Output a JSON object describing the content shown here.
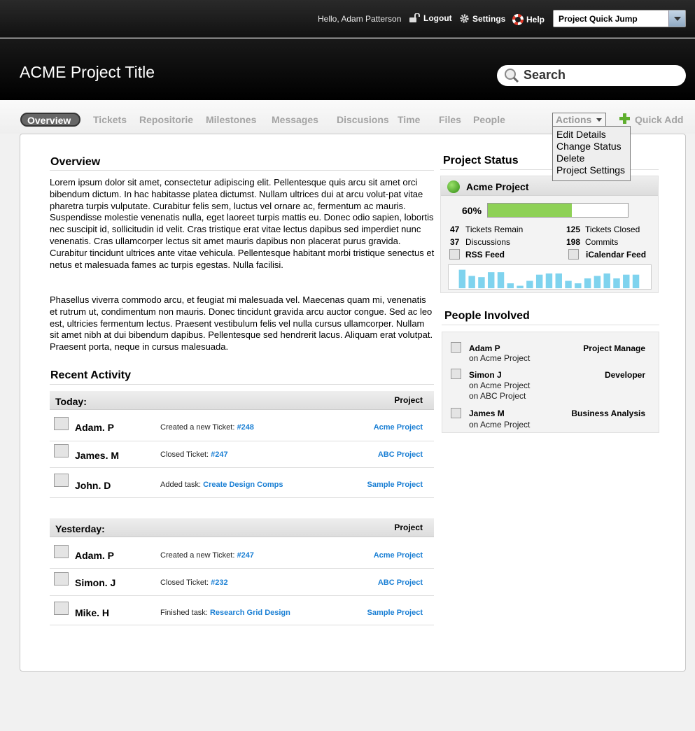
{
  "topbar": {
    "greeting": "Hello, Adam Patterson",
    "logout": "Logout",
    "settings": "Settings",
    "help": "Help",
    "quick_jump": "Project Quick Jump"
  },
  "header": {
    "title": "ACME Project Title",
    "search_placeholder": "Search"
  },
  "nav": {
    "items": [
      "Overview",
      "Tickets",
      "Repositorie",
      "Milestones",
      "Messages",
      "Discusions",
      "Time",
      "Files",
      "People"
    ],
    "actions": "Actions",
    "actions_menu": [
      "Edit Details",
      "Change Status",
      "Delete",
      "Project Settings"
    ],
    "quick_add": "Quick Add"
  },
  "overview": {
    "heading": "Overview",
    "para1": "Lorem ipsum dolor sit amet, consectetur adipiscing elit. Pellentesque quis arcu sit amet orci bibendum dictum. In hac habitasse platea dictumst. Nullam ultrices dui at arcu volut-pat vitae pharetra turpis vulputate. Curabitur felis sem, luctus vel ornare ac, fermentum ac mauris. Suspendisse molestie venenatis nulla, eget laoreet turpis mattis eu. Donec odio sapien, lobortis nec suscipit id, sollicitudin id velit. Cras tristique erat vitae lectus dapibus sed imperdiet nunc venenatis. Cras ullamcorper lectus sit amet mauris dapibus non placerat purus gravida. Curabitur tincidunt ultrices ante vitae vehicula. Pellentesque habitant morbi tristique senectus et netus et malesuada fames ac turpis egestas. Nulla facilisi.",
    "para2": "Phasellus viverra commodo arcu, et feugiat mi malesuada vel. Maecenas quam mi, venenatis et rutrum ut, condimentum non mauris. Donec tincidunt gravida arcu auctor congue. Sed ac leo est, ultricies fermentum lectus. Praesent vestibulum felis vel nulla cursus ullamcorper. Nullam sit amet nibh at dui bibendum dapibus. Pellentesque sed hendrerit lacus. Aliquam erat volutpat. Praesent porta, neque in cursus malesuada."
  },
  "activity": {
    "heading": "Recent Activity",
    "groups": [
      {
        "label": "Today:",
        "col": "Project",
        "rows": [
          {
            "name": "Adam. P",
            "action": "Created a new Ticket:",
            "target": "#248",
            "project": "Acme Project"
          },
          {
            "name": "James. M",
            "action": "Closed Ticket:",
            "target": "#247",
            "project": "ABC Project"
          },
          {
            "name": "John. D",
            "action": "Added task:",
            "target": "Create Design Comps",
            "project": "Sample Project"
          }
        ]
      },
      {
        "label": "Yesterday:",
        "col": "Project",
        "rows": [
          {
            "name": "Adam. P",
            "action": "Created a new Ticket:",
            "target": "#247",
            "project": "Acme Project"
          },
          {
            "name": "Simon. J",
            "action": "Closed Ticket:",
            "target": "#232",
            "project": "ABC Project"
          },
          {
            "name": "Mike. H",
            "action": "Finished task:",
            "target": "Research Grid Design",
            "project": "Sample Project"
          }
        ]
      }
    ]
  },
  "status": {
    "heading": "Project Status",
    "project": "Acme Project",
    "progress_label": "60%",
    "progress": 0.6,
    "stats": {
      "tickets_remain_n": "47",
      "tickets_remain": "Tickets Remain",
      "tickets_closed_n": "125",
      "tickets_closed": "Tickets Closed",
      "discussions_n": "37",
      "discussions": "Discussions",
      "commits_n": "198",
      "commits": "Commits"
    },
    "rss": "RSS Feed",
    "ical": "iCalendar Feed",
    "activity_levels": [
      30,
      20,
      18,
      26,
      26,
      8,
      4,
      12,
      22,
      24,
      24,
      12,
      8,
      16,
      20,
      24,
      16,
      22,
      22
    ]
  },
  "people": {
    "heading": "People Involved",
    "list": [
      {
        "name": "Adam P",
        "projects": [
          "on Acme Project"
        ],
        "role": "Project Manage"
      },
      {
        "name": "Simon J",
        "projects": [
          "on Acme Project",
          "on ABC Project"
        ],
        "role": "Developer"
      },
      {
        "name": "James M",
        "projects": [
          "on Acme Project"
        ],
        "role": "Business Analysis"
      }
    ]
  },
  "colors": {
    "link": "#1a7fd4",
    "progress": "#8ed156",
    "spark": "#7fd3ee"
  }
}
